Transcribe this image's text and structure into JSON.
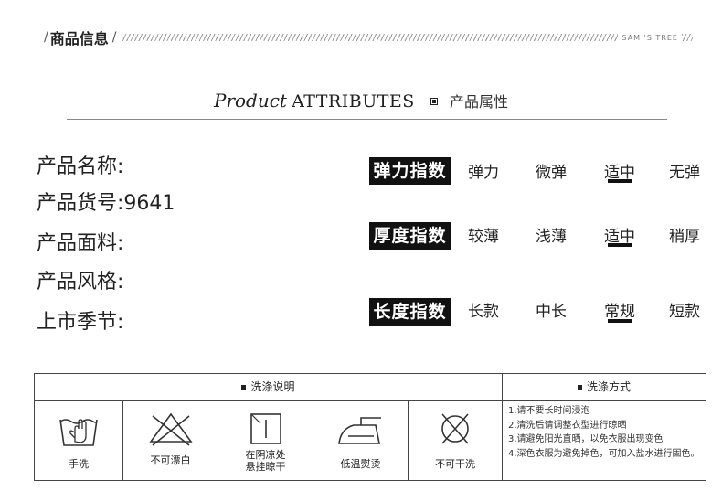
{
  "header": {
    "title": "商品信息",
    "brand": "SAM 'S TREE"
  },
  "section": {
    "title_italic": "Product",
    "title_caps": "ATTRIBUTES",
    "title_cn": "产品属性"
  },
  "info": {
    "name_label": "产品名称:",
    "sku_label": "产品货号:",
    "sku_value": "9641",
    "fabric_label": "产品面料:",
    "style_label": "产品风格:",
    "season_label": "上市季节:"
  },
  "ratings": [
    {
      "label": "弹力指数",
      "options": [
        "弹力",
        "微弹",
        "适中",
        "无弹"
      ],
      "selected_index": 2
    },
    {
      "label": "厚度指数",
      "options": [
        "较薄",
        "浅薄",
        "适中",
        "稍厚"
      ],
      "selected_index": 2
    },
    {
      "label": "长度指数",
      "options": [
        "长款",
        "中长",
        "常规",
        "短款"
      ],
      "selected_index": 2
    }
  ],
  "care": {
    "icons_header": "洗涤说明",
    "method_header": "洗涤方式",
    "icons": [
      {
        "name": "hand-wash-icon",
        "label": "手洗"
      },
      {
        "name": "no-bleach-icon",
        "label": "不可漂白"
      },
      {
        "name": "shade-hang-dry-icon",
        "label_line1": "在阴凉处",
        "label_line2": "悬挂晾干"
      },
      {
        "name": "low-iron-icon",
        "label": "低温熨烫"
      },
      {
        "name": "no-dry-clean-icon",
        "label": "不可干洗"
      }
    ],
    "tips": [
      "1.请不要长时间浸泡",
      "2.清洗后请调整衣型进行晾晒",
      "3.请避免阳光直晒，以免衣服出现变色",
      "4.深色衣服为避免掉色，可加入盐水进行固色。"
    ]
  },
  "colors": {
    "label_bg": "#111111",
    "label_fg": "#ffffff",
    "line": "#888888"
  }
}
